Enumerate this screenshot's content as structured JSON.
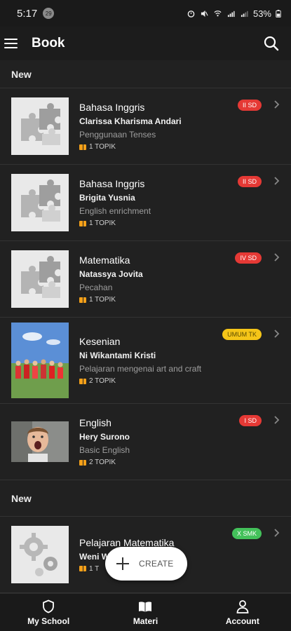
{
  "status": {
    "time": "5:17",
    "notif_badge": "29",
    "battery": "53%"
  },
  "appbar": {
    "title": "Book"
  },
  "sections": [
    {
      "header": "New",
      "cards": [
        {
          "subject": "Bahasa Inggris",
          "teacher": "Clarissa Kharisma Andari",
          "desc": "Penggunaan Tenses",
          "topik": "1 TOPIK",
          "tag": "II SD",
          "tag_color": "#e53935",
          "thumb": "puzzle-placeholder"
        },
        {
          "subject": "Bahasa Inggris",
          "teacher": "Brigita Yusnia",
          "desc": "English enrichment",
          "topik": "1 TOPIK",
          "tag": "II SD",
          "tag_color": "#e53935",
          "thumb": "puzzle-placeholder"
        },
        {
          "subject": "Matematika",
          "teacher": "Natassya Jovita",
          "desc": "Pecahan",
          "topik": "1 TOPIK",
          "tag": "IV SD",
          "tag_color": "#e53935",
          "thumb": "puzzle-placeholder"
        },
        {
          "subject": "Kesenian",
          "teacher": "Ni Wikantami Kristi",
          "desc": "Pelajaran mengenai art and craft",
          "topik": "2 TOPIK",
          "tag": "UMUM TK",
          "tag_color": "#f5c518",
          "thumb": "group-photo"
        },
        {
          "subject": "English",
          "teacher": "Hery Surono",
          "desc": "Basic English",
          "topik": "2 TOPIK",
          "tag": "I SD",
          "tag_color": "#e53935",
          "thumb": "child-photo"
        }
      ]
    },
    {
      "header": "New",
      "cards": [
        {
          "subject": "Pelajaran Matematika",
          "teacher": "Weni W",
          "desc": "",
          "topik": "1 T",
          "tag": "X SMK",
          "tag_color": "#43c15a",
          "thumb": "gear-placeholder"
        }
      ]
    }
  ],
  "fab": {
    "label": "CREATE"
  },
  "bottom_nav": [
    {
      "label": "My School",
      "icon": "shield-icon"
    },
    {
      "label": "Materi",
      "icon": "book-open-icon"
    },
    {
      "label": "Account",
      "icon": "person-icon"
    }
  ]
}
